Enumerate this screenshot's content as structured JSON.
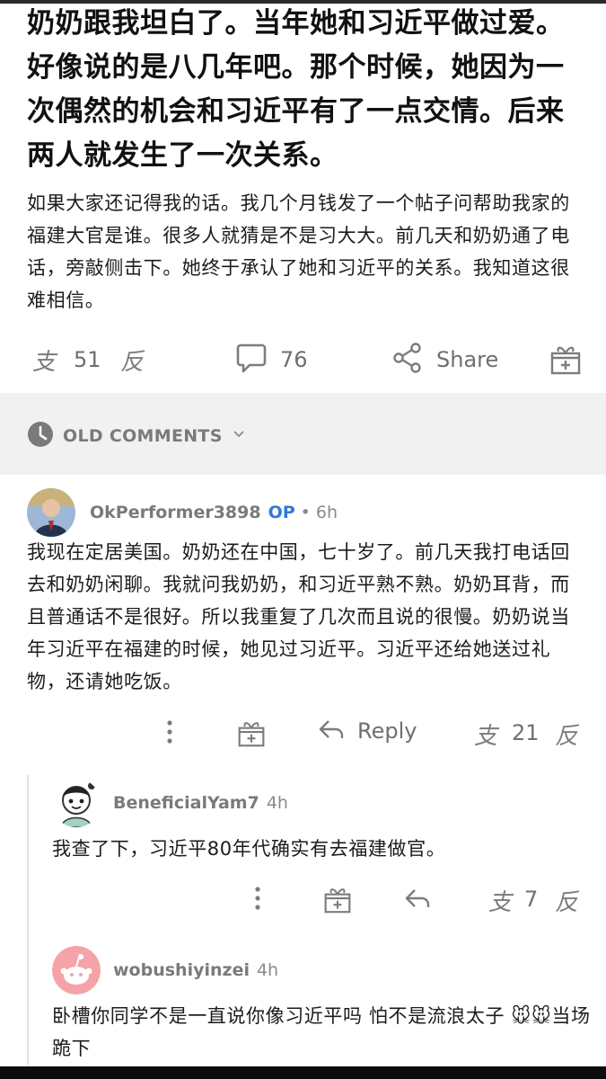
{
  "post": {
    "title": "奶奶跟我坦白了。当年她和习近平做过爱。好像说的是八几年吧。那个时候，她因为一次偶然的机会和习近平有了一点交情。后来两人就发生了一次关系。",
    "body": "如果大家还记得我的话。我几个月钱发了一个帖子问帮助我家的福建大官是谁。很多人就猜是不是习大大。前几天和奶奶通了电话，旁敲侧击下。她终于承认了她和习近平的关系。我知道这很难相信。",
    "upvote_glyph": "支",
    "downvote_glyph": "反",
    "vote_count": "51",
    "comment_count": "76",
    "share_label": "Share"
  },
  "old_comments_label": "OLD COMMENTS",
  "comments": [
    {
      "username": "OkPerformer3898",
      "op_label": "OP",
      "time": "• 6h",
      "text": "我现在定居美国。奶奶还在中国，七十岁了。前几天我打电话回去和奶奶闲聊。我就问我奶奶，和习近平熟不熟。奶奶耳背，而且普通话不是很好。所以我重复了几次而且说的很慢。奶奶说当年习近平在福建的时候，她见过习近平。习近平还给她送过礼物，还请她吃饭。",
      "reply_label": "Reply",
      "vote_count": "21",
      "upvote_glyph": "支",
      "downvote_glyph": "反"
    },
    {
      "username": "BeneficialYam7",
      "time": "4h",
      "text": "我查了下，习近平80年代确实有去福建做官。",
      "vote_count": "7",
      "upvote_glyph": "支",
      "downvote_glyph": "反"
    },
    {
      "username": "wobushiyinzei",
      "time": "4h",
      "text": "卧槽你同学不是一直说你像习近平吗 怕不是流浪太子 🐭🐭当场跪下"
    }
  ],
  "colors": {
    "accent_op": "#2e7bd6",
    "muted": "#7c7c7c",
    "divider_band": "#f1f1f1",
    "reddit_avatar": "#f5a3a8"
  }
}
